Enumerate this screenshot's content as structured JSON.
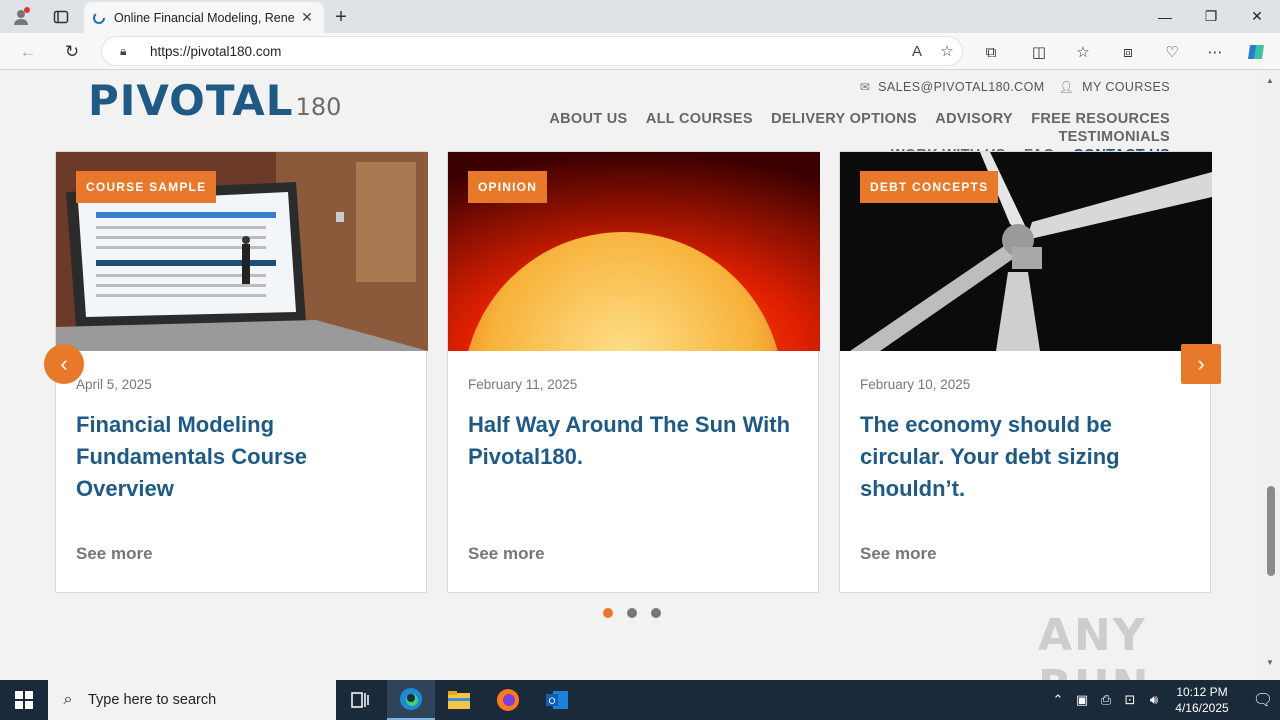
{
  "browser": {
    "tab_title": "Online Financial Modeling, Rene",
    "url": "https://pivotal180.com"
  },
  "site": {
    "logo_text": "PIVOTAL",
    "logo_number": "180",
    "topbar": {
      "email": "SALES@PIVOTAL180.COM",
      "courses": "MY COURSES"
    },
    "nav": [
      "ABOUT US",
      "ALL COURSES",
      "DELIVERY OPTIONS",
      "ADVISORY",
      "FREE RESOURCES",
      "TESTIMONIALS",
      "WORK WITH US",
      "FAQ",
      "CONTACT US"
    ],
    "cards": [
      {
        "category": "COURSE SAMPLE",
        "date": "April 5, 2025",
        "title": "Financial Modeling Fundamentals Course Overview",
        "more": "See more"
      },
      {
        "category": "OPINION",
        "date": "February 11, 2025",
        "title": "Half Way Around The Sun With Pivotal180.",
        "more": "See more"
      },
      {
        "category": "DEBT CONCEPTS",
        "date": "February 10, 2025",
        "title": "The economy should be circular. Your debt sizing shouldn’t.",
        "more": "See more"
      }
    ],
    "carousel_active_dot": 0,
    "carousel_dot_count": 3
  },
  "watermark": "ANY RUN",
  "taskbar": {
    "search_placeholder": "Type here to search",
    "time": "10:12 PM",
    "date": "4/16/2025"
  },
  "colors": {
    "accent": "#e8792b",
    "brand_blue": "#1f5a84"
  }
}
